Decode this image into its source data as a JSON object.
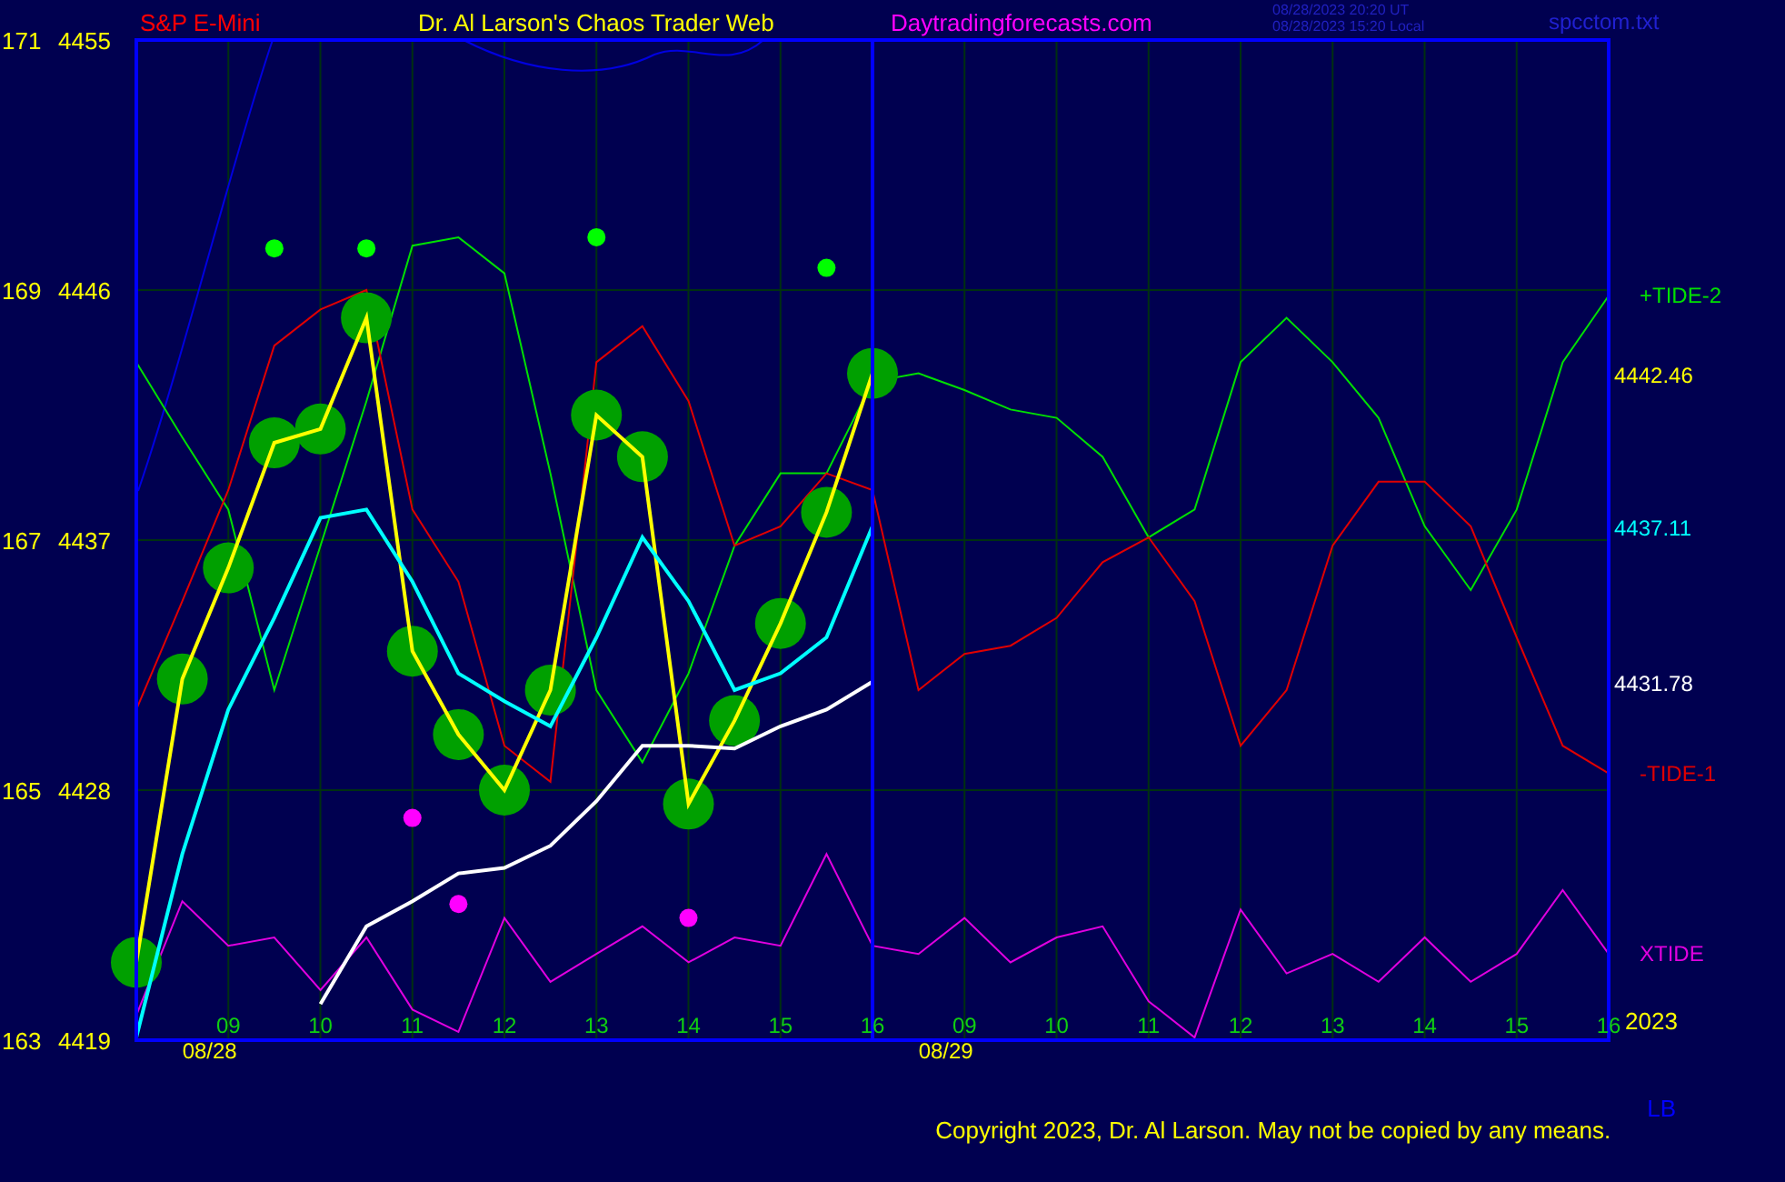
{
  "header": {
    "instrument": "S&P E-Mini",
    "title": "Dr. Al Larson's Chaos Trader Web",
    "site": "Daytradingforecasts.com",
    "timestamps": [
      "08/28/2023 20:20 UT",
      "08/28/2023 15:20 Local"
    ],
    "file": "spcctom.txt"
  },
  "chart": {
    "chart_data": {
      "type": "line",
      "categories": [
        null,
        null,
        "09",
        null,
        "10",
        null,
        "11",
        null,
        "12",
        null,
        "13",
        null,
        "14",
        null,
        "15",
        null,
        "16",
        null,
        "09",
        null,
        "10",
        null,
        "11",
        null,
        "12",
        null,
        "13",
        null,
        "14",
        null,
        "15",
        null,
        "16"
      ],
      "series": [
        {
          "color": "#ffff00",
          "marker": "o",
          "values": [
            4421.8,
            4432,
            4436,
            4440.5,
            4441,
            4445,
            4433,
            4430,
            4428,
            4431.6,
            4441.5,
            4440,
            4427.5,
            4430.5,
            4434,
            4438,
            4443,
            null,
            null,
            null,
            null,
            null,
            null,
            null,
            null,
            null,
            null,
            null,
            null,
            null,
            null,
            null,
            null
          ]
        },
        {
          "color": "#00ffff",
          "values": [
            4419.1,
            4425.7,
            4430.9,
            4434.2,
            4437.8,
            4438.1,
            4435.5,
            4432.2,
            4431.2,
            4430.3,
            4433.5,
            4437.1,
            4434.8,
            4431.6,
            4432.2,
            4433.5,
            4437.5,
            null,
            null,
            null,
            null,
            null,
            null,
            null,
            null,
            null,
            null,
            null,
            null,
            null,
            null,
            null,
            null
          ]
        },
        {
          "color": "#ffffff",
          "values": [
            null,
            null,
            null,
            null,
            4420.3,
            4423.1,
            4424,
            4425,
            4425.2,
            4426,
            4427.6,
            4429.6,
            4429.6,
            4429.5,
            4430.3,
            4430.9,
            4431.9,
            null,
            null,
            null,
            null,
            null,
            null,
            null,
            null,
            null,
            null,
            null,
            null,
            null,
            null,
            null,
            null
          ]
        },
        {
          "name": "+TIDE-2",
          "color": "#00e000",
          "values": [
            4443.4,
            4440.7,
            4438.1,
            4431.6,
            4436.8,
            4442,
            4447.6,
            4447.9,
            4446.6,
            4439.4,
            4431.6,
            4429,
            4432.2,
            4436.8,
            4439.4,
            4439.4,
            4442.7,
            4443,
            4442.4,
            4441.7,
            4441.4,
            4440,
            4437.1,
            4438.1,
            4443.4,
            4445,
            4443.4,
            4441.4,
            4437.5,
            4435.2,
            4438.1,
            4443.4,
            4445.8
          ]
        },
        {
          "name": "-TIDE-1",
          "color": "#e00000",
          "values": [
            4430.9,
            4434.8,
            4438.8,
            4444,
            4445.3,
            4446,
            4438.1,
            4435.5,
            4429.6,
            4428.3,
            4443.4,
            4444.7,
            4442,
            4436.8,
            4437.5,
            4439.4,
            4438.8,
            4431.6,
            4432.9,
            4433.2,
            4434.2,
            4436.2,
            4437.1,
            4434.8,
            4429.6,
            4431.6,
            4436.8,
            4439.1,
            4439.1,
            4437.5,
            4433.5,
            4429.6,
            4428.6
          ]
        },
        {
          "name": "XTIDE",
          "color": "#e000e0",
          "values": [
            4419.9,
            4424.0,
            4422.4,
            4422.7,
            4420.8,
            4422.7,
            4420.1,
            4419.3,
            4423.4,
            4421.1,
            4422.1,
            4423.1,
            4421.8,
            4422.7,
            4422.4,
            4425.7,
            4422.4,
            4422.1,
            4423.4,
            4421.8,
            4422.7,
            4423.1,
            4420.4,
            4419.1,
            4423.7,
            4421.4,
            4422.1,
            4421.1,
            4422.7,
            4421.1,
            4422.1,
            4424.4,
            4422.1
          ]
        },
        {
          "type": "scatter",
          "color": "#00ff00",
          "values": [
            null,
            null,
            null,
            4447.5,
            null,
            4447.5,
            null,
            null,
            null,
            null,
            4447.9,
            null,
            null,
            null,
            null,
            4446.8,
            null,
            null,
            null,
            null,
            null,
            null,
            null,
            null,
            null,
            null,
            null,
            null,
            null,
            null,
            null,
            null,
            null
          ]
        },
        {
          "type": "scatter",
          "color": "#ff00ff",
          "values": [
            null,
            null,
            null,
            null,
            null,
            null,
            4427,
            4423.9,
            null,
            null,
            null,
            null,
            4423.4,
            null,
            null,
            null,
            null,
            null,
            null,
            null,
            null,
            null,
            null,
            null,
            null,
            null,
            null,
            null,
            null,
            null,
            null,
            null,
            null
          ]
        }
      ],
      "ylim": [
        4419,
        4455
      ],
      "grid": true,
      "yticks": [
        4455,
        4446,
        4437,
        4428,
        4419
      ]
    },
    "cycle_labels": [
      "171",
      "169",
      "167",
      "165",
      "163"
    ],
    "dates": [
      "08/28",
      "08/29"
    ],
    "year": "2023",
    "right_labels": [
      {
        "text": "4442.46",
        "color": "#ffff00"
      },
      {
        "text": "4437.11",
        "color": "#00ffff"
      },
      {
        "text": "4431.78",
        "color": "#ffffff"
      }
    ]
  },
  "footer": {
    "copyright": "Copyright 2023, Dr. Al Larson. May not be copied by any means.",
    "initials": "LB"
  }
}
